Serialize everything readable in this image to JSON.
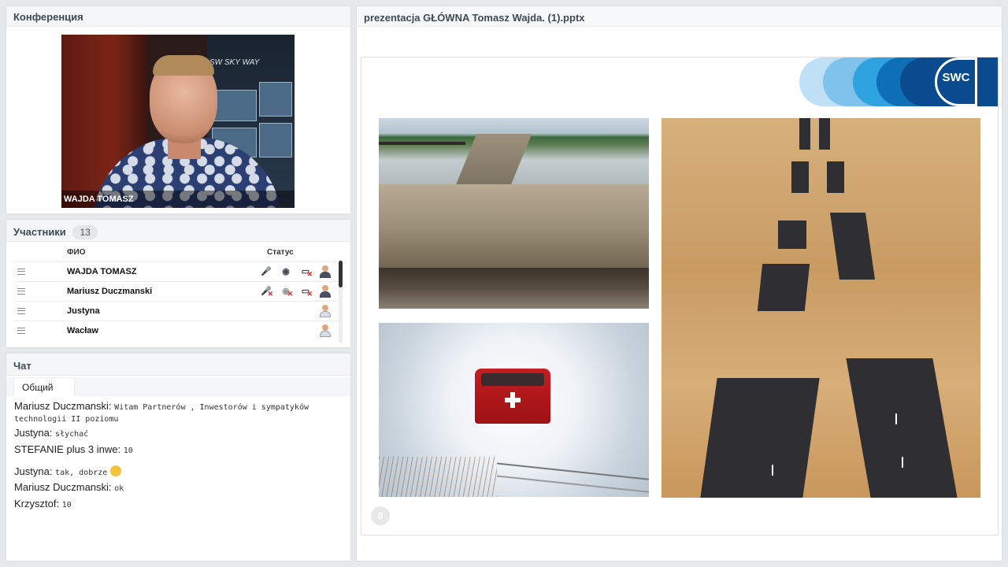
{
  "conference": {
    "title": "Конференция",
    "video_name": "WAJDA  TOMASZ",
    "banner_text": "SW  SKY WAY"
  },
  "participants": {
    "title": "Участники",
    "count": "13",
    "col_name": "ФИО",
    "col_status": "Статус",
    "rows": [
      {
        "name": "WAJDA  TOMASZ"
      },
      {
        "name": "Mariusz Duczmanski"
      },
      {
        "name": "Justyna"
      },
      {
        "name": "Wacław"
      }
    ]
  },
  "chat": {
    "title": "Чат",
    "tab": "Общий",
    "messages": [
      {
        "author": "Mariusz Duczmanski:",
        "text": "Witam Partnerów , Inwestorów i sympatyków technologii II poziomu"
      },
      {
        "author": "Justyna:",
        "text": "słychać"
      },
      {
        "author": "STEFANIE plus 3 inwe:",
        "text": "10"
      },
      {
        "author": "Justyna:",
        "text": "tak, dobrze"
      },
      {
        "author": "Mariusz Duczmanski:",
        "text": "ok"
      },
      {
        "author": "Krzysztof:",
        "text": "10"
      }
    ]
  },
  "presentation": {
    "title": "prezentacja GŁÓWNA Tomasz Wajda. (1).pptx",
    "logo_text": "SWC",
    "page_number": "8"
  },
  "colors": {
    "logo_blue_1": "#bfe0f5",
    "logo_blue_2": "#7fc3ec",
    "logo_blue_3": "#2fa3e0",
    "logo_blue_4": "#0f6fb6",
    "logo_blue_5": "#0a4a8f"
  }
}
